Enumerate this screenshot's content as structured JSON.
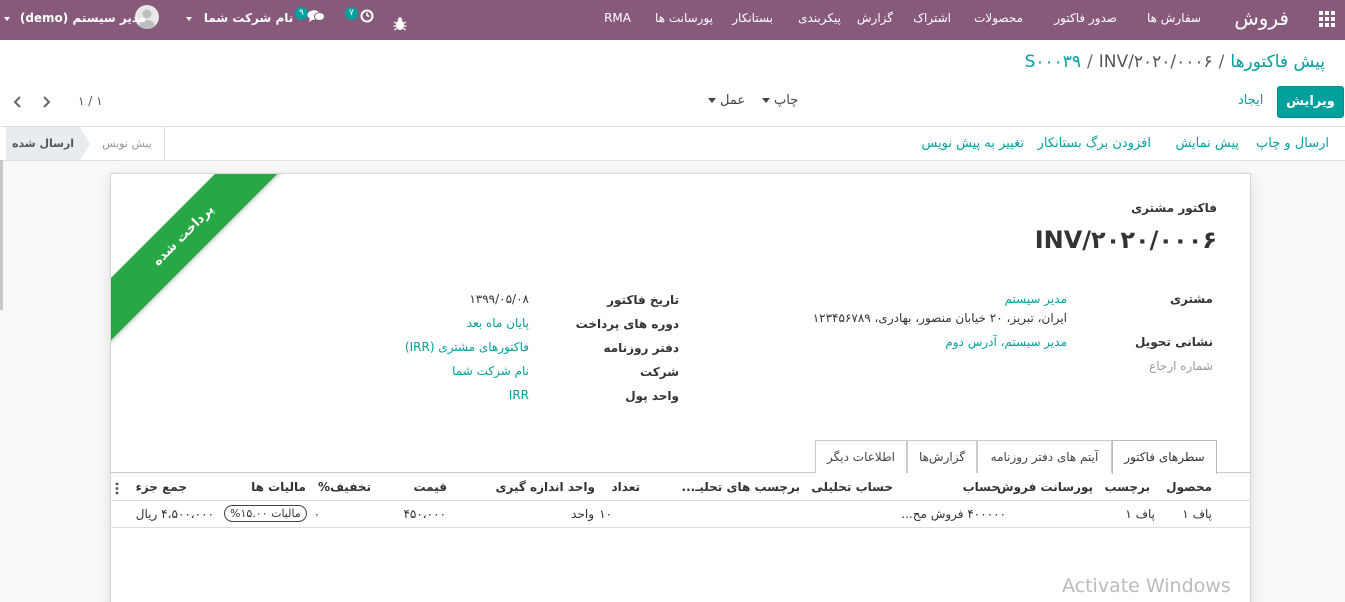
{
  "navbar": {
    "app_name": "فروش",
    "menus": [
      "سفارش ها",
      "صدور فاکتور",
      "محصولات",
      "اشتراک",
      "گزارش",
      "پیکربندی",
      "بستانکار",
      "پورسانت ها",
      "RMA"
    ],
    "user": "مدیر سیستم (demo)",
    "company": "نام شرکت شما",
    "messages_count": "۹",
    "activities_count": "۷",
    "icons": [
      "apps-grid-icon",
      "debug-bug-icon",
      "clock-activity-icon",
      "chat-bubbles-icon",
      "avatar-icon"
    ]
  },
  "breadcrumb": {
    "root": "پیش فاکتورها",
    "middle": "S۰۰۰۳۹",
    "current": "INV/۲۰۲۰/۰۰۰۶"
  },
  "controls": {
    "edit": "ویرایش",
    "create": "ایجاد",
    "print": "چاپ",
    "action": "عمل",
    "pager": "۱ / ۱"
  },
  "statusbar": {
    "buttons": [
      "ارسال و چاپ",
      "پیش نمایش",
      "افزودن برگ بستانکار",
      "تغییر به پیش نویس"
    ],
    "stage_active": "ارسال شده",
    "stage_inactive": "پیش نویس"
  },
  "sheet": {
    "ribbon": "پرداخت شده",
    "doc_type": "فاکتور مشتری",
    "doc_number": "INV/۲۰۲۰/۰۰۰۶",
    "left_fields": {
      "customer_label": "مشتری",
      "customer_name": "مدیر سیستم",
      "customer_address": "ایران، تبریز، ۲۰ خیابان منصور، بهادری، ۱۲۳۴۵۶۷۸۹",
      "delivery_label": "نشانی تحویل",
      "delivery_value": "مدیر سیستم، آدرس دوم",
      "reference_placeholder": "شماره ارجاع"
    },
    "right_fields": {
      "invoice_date_label": "تاریخ فاکتور",
      "invoice_date": "۱۳۹۹/۰۵/۰۸",
      "payment_terms_label": "دوره های پرداخت",
      "payment_terms": "پایان ماه بعد",
      "journal_label": "دفتر روزنامه",
      "journal": "فاکتورهای مشتری (IRR)",
      "company_label": "شرکت",
      "company": "نام شرکت شما",
      "currency_label": "واحد پول",
      "currency": "IRR"
    },
    "tabs": [
      "سطرهای فاکتور",
      "آیتم های دفتر روزنامه",
      "گزارش‌ها",
      "اطلاعات دیگر"
    ],
    "table": {
      "headers": {
        "product": "محصول",
        "label": "برچسب",
        "commission": "پورسانت فروش",
        "account": "حساب",
        "analytic": "حساب تحلیلی",
        "analytic_tags": "برچسب های تحلیـ...",
        "qty": "تعداد",
        "uom": "واحد اندازه گیری",
        "price": "قیمت",
        "discount": "تخفیف%",
        "taxes": "مالیات ها",
        "subtotal": "جمع جزء"
      },
      "row": {
        "product": "پاف ۱",
        "label": "پاف ۱",
        "account": "۴۰۰۰۰۰ فروش مح...",
        "qty": "۱۰",
        "uom": "واحد",
        "price": "۴۵۰،۰۰۰",
        "discount": "۰",
        "taxes": "مالیات ۱۵.۰۰%",
        "subtotal": "۴،۵۰۰،۰۰۰ ریال"
      }
    }
  },
  "watermark": "Activate Windows"
}
